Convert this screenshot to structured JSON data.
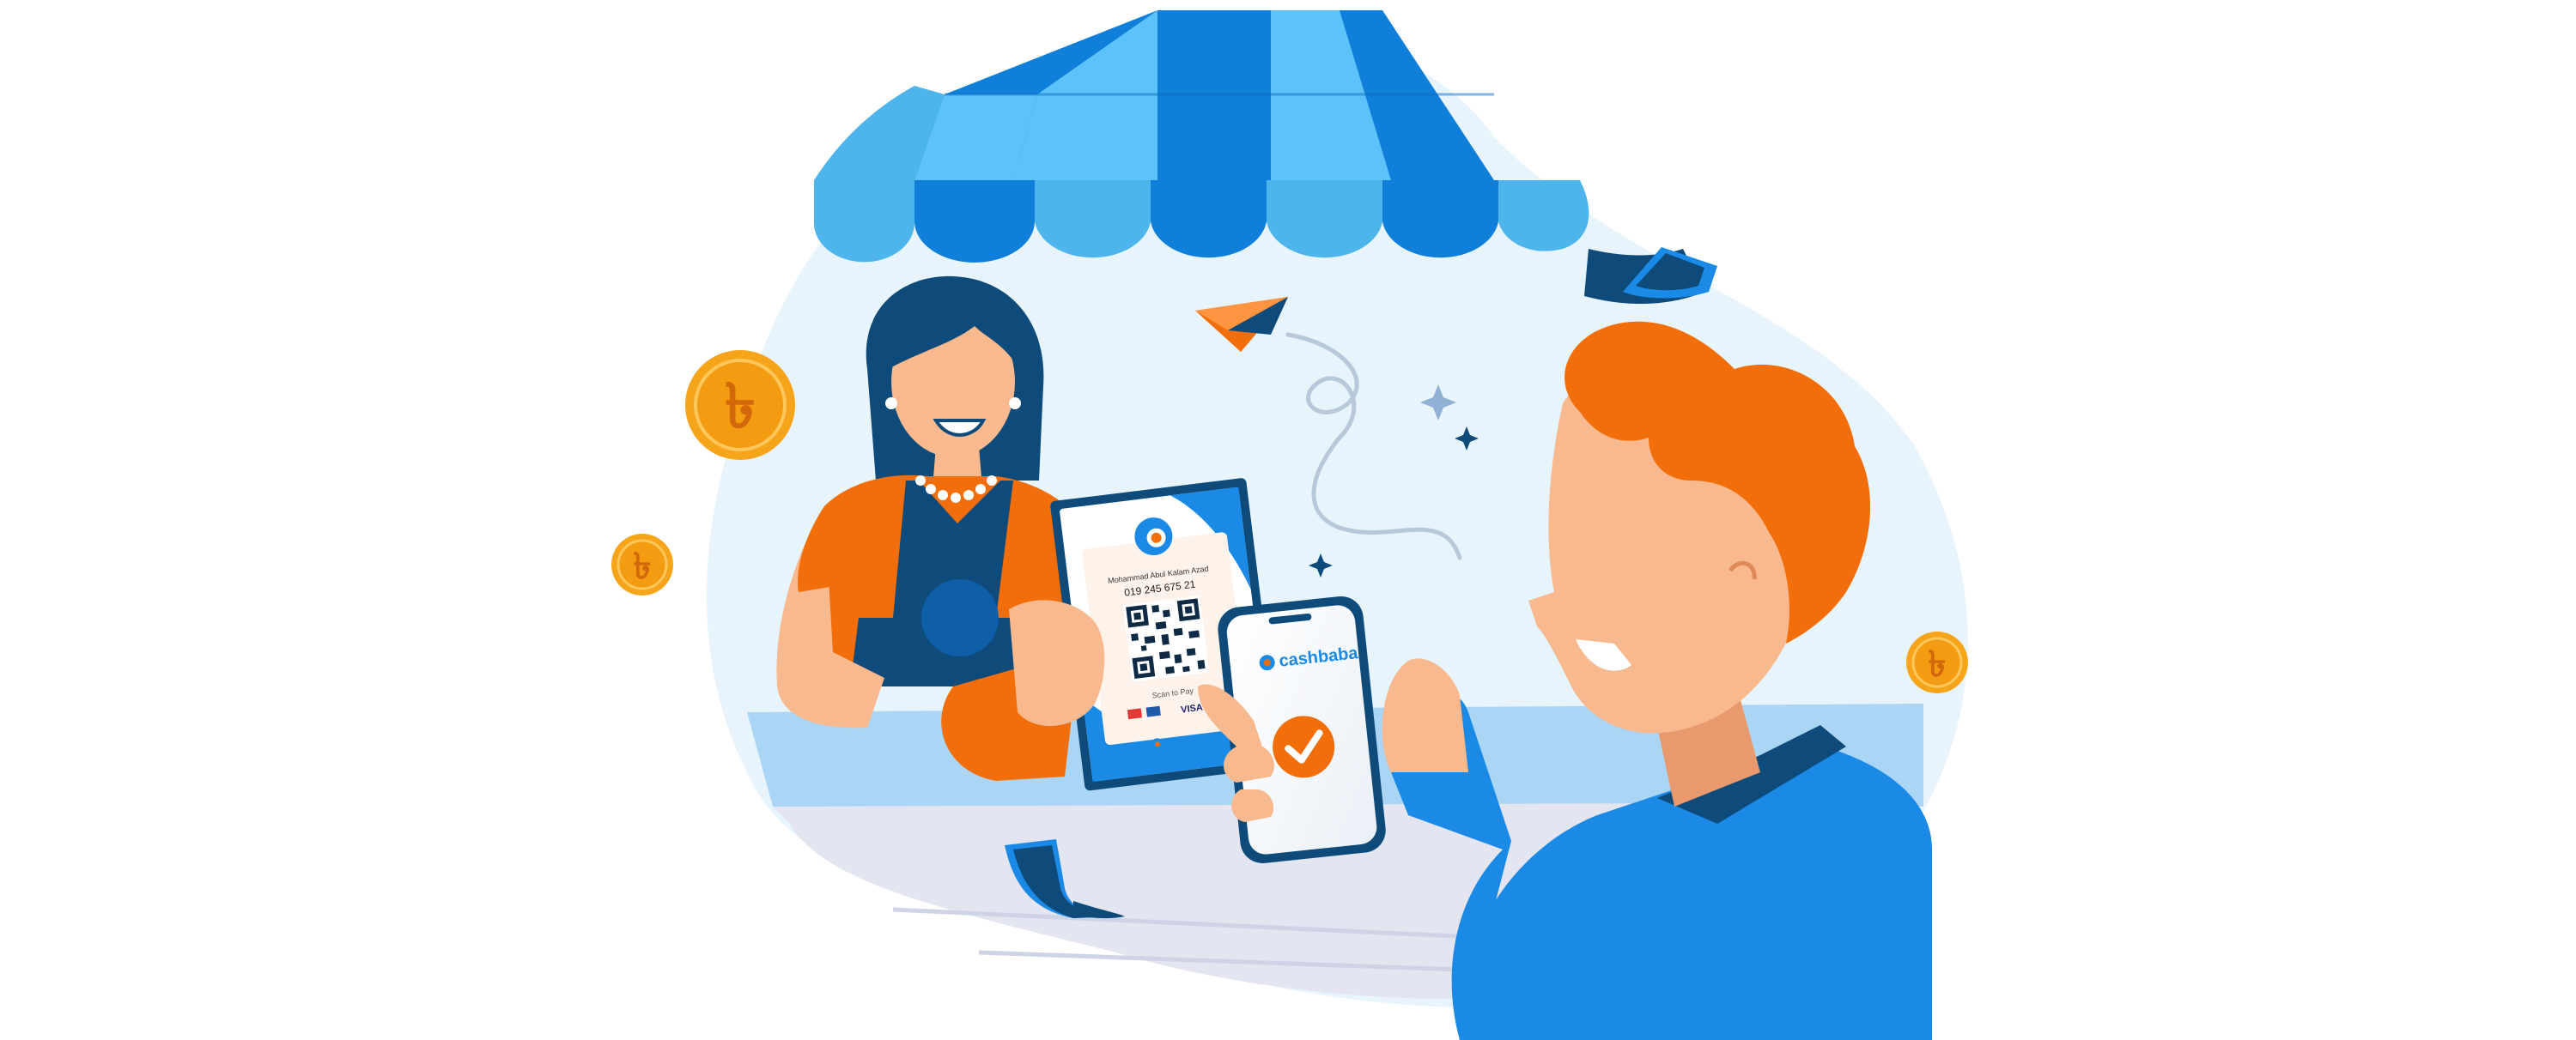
{
  "qr_card": {
    "name": "Mohammad Abul Kalam Azad",
    "phone": "019 245 675 21",
    "scan_label": "Scan to Pay",
    "visa_label": "VISA",
    "brand": "cashbaba"
  },
  "phone": {
    "brand": "cashbaba"
  },
  "coins": {
    "symbol": "৳"
  },
  "colors": {
    "primary_blue": "#0F7FD9",
    "light_blue": "#5CC2F9",
    "navy": "#0E4B7A",
    "orange": "#F26E0A",
    "coin_gold": "#F6A51B",
    "skin": "#F7B98D",
    "counter": "#E3E5F0",
    "background_blob": "#E7F4FC"
  },
  "icons": [
    "store-awning",
    "paper-plane-icon",
    "sparkle-icon",
    "coin-taka-icon",
    "check-icon",
    "qr-code-icon",
    "banknote-icon"
  ]
}
